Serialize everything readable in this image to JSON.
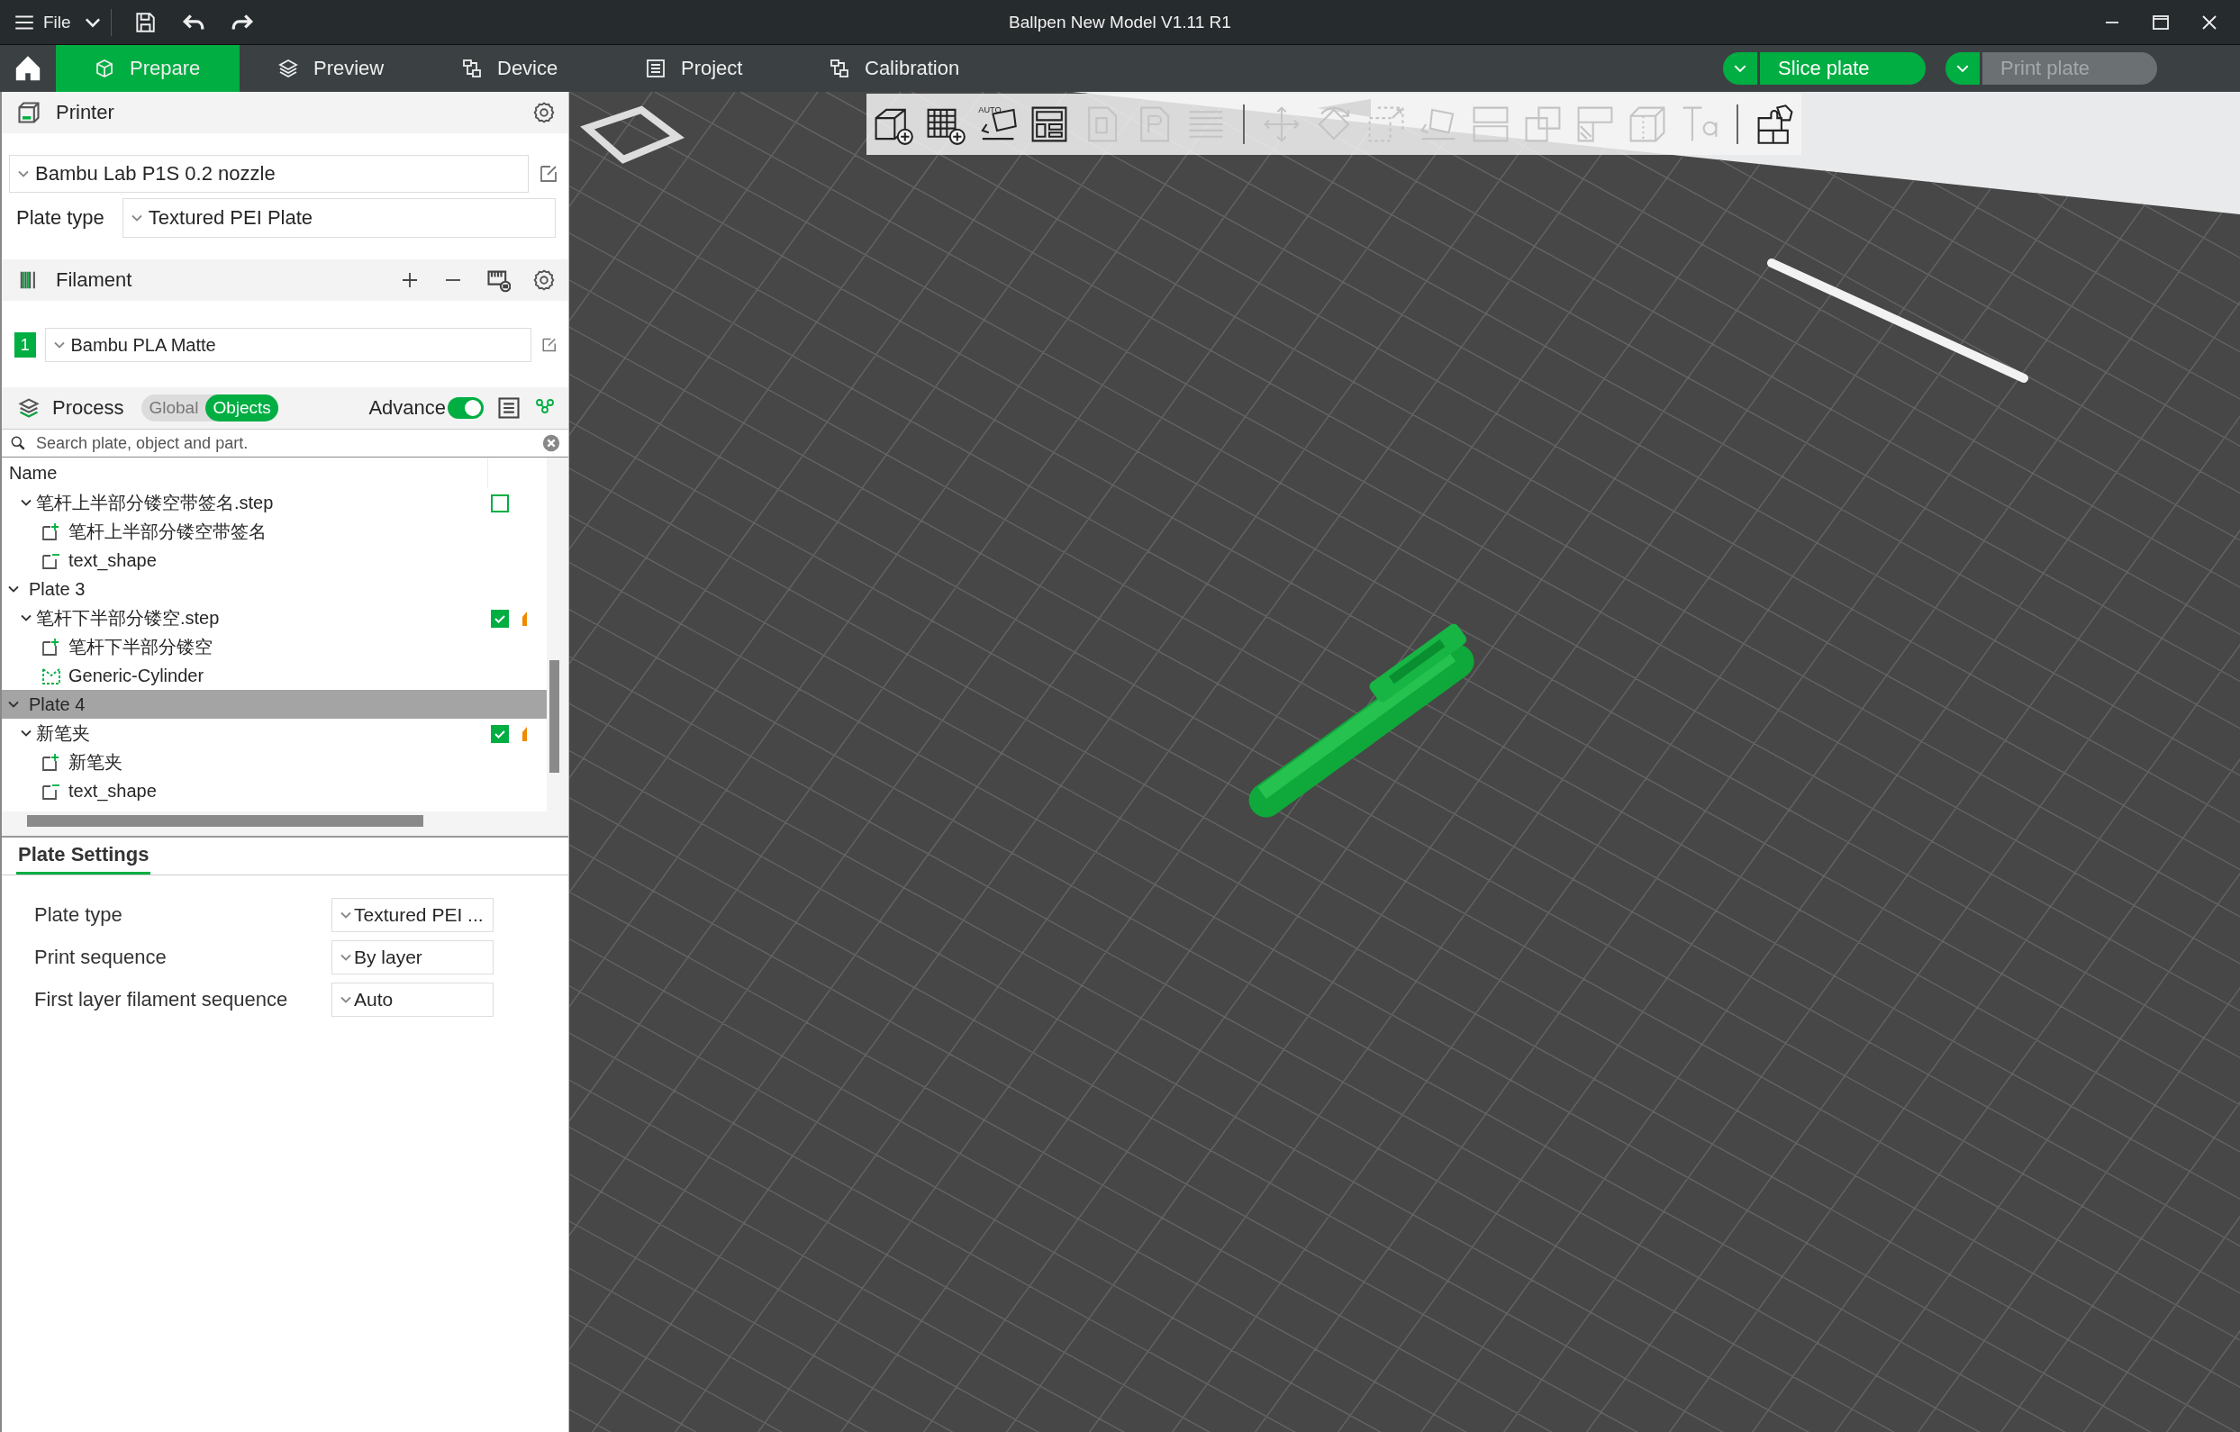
{
  "title_bar": {
    "menu": "File",
    "title": "Ballpen New Model V1.11 R1"
  },
  "tabs": [
    {
      "label": "Prepare",
      "selected": true
    },
    {
      "label": "Preview",
      "selected": false
    },
    {
      "label": "Device",
      "selected": false
    },
    {
      "label": "Project",
      "selected": false
    },
    {
      "label": "Calibration",
      "selected": false
    }
  ],
  "actions": [
    {
      "label": "Slice plate",
      "disabled": false
    },
    {
      "label": "Print plate",
      "disabled": true
    }
  ],
  "printer": {
    "heading": "Printer",
    "preset": "Bambu Lab P1S 0.2 nozzle",
    "plate_type_label": "Plate type",
    "plate_type": "Textured PEI Plate"
  },
  "filament": {
    "heading": "Filament",
    "items": [
      {
        "number": "1",
        "name": "Bambu PLA Matte",
        "color": "#00ae42"
      }
    ]
  },
  "process": {
    "heading": "Process",
    "scopes": [
      {
        "label": "Global",
        "selected": false
      },
      {
        "label": "Objects",
        "selected": true
      }
    ],
    "advance_label": "Advance",
    "advance_on": true,
    "search_placeholder": "Search plate, object and part."
  },
  "object_list": {
    "column": "Name",
    "items": [
      {
        "kind": "object",
        "name": "笔杆上半部分镂空带签名.step",
        "expanded": true,
        "checked": false,
        "badge": false,
        "selected": false,
        "children": [
          {
            "kind": "part",
            "name": "笔杆上半部分镂空带签名",
            "selected": false
          },
          {
            "kind": "text",
            "name": "text_shape",
            "selected": false
          }
        ]
      },
      {
        "kind": "plate",
        "name": "Plate 3",
        "expanded": true,
        "selected": false,
        "children": [
          {
            "kind": "object",
            "name": "笔杆下半部分镂空.step",
            "expanded": true,
            "checked": true,
            "badge": true,
            "selected": false,
            "children": [
              {
                "kind": "part",
                "name": "笔杆下半部分镂空",
                "selected": false
              },
              {
                "kind": "modifier",
                "name": "Generic-Cylinder",
                "selected": false
              }
            ]
          }
        ]
      },
      {
        "kind": "plate",
        "name": "Plate 4",
        "expanded": true,
        "selected": true,
        "children": [
          {
            "kind": "object",
            "name": "新笔夹",
            "expanded": true,
            "checked": true,
            "badge": true,
            "selected": false,
            "children": [
              {
                "kind": "part",
                "name": "新笔夹",
                "selected": false
              },
              {
                "kind": "text",
                "name": "text_shape",
                "selected": false
              }
            ]
          }
        ]
      }
    ]
  },
  "plate_settings": {
    "tab": "Plate Settings",
    "rows": [
      {
        "label": "Plate type",
        "value": "Textured PEI ..."
      },
      {
        "label": "Print sequence",
        "value": "By layer"
      },
      {
        "label": "First layer filament sequence",
        "value": "Auto"
      }
    ]
  },
  "toolbar": [
    [
      {
        "kind": "add",
        "disabled": false
      },
      {
        "kind": "plate",
        "disabled": false
      },
      {
        "kind": "orient",
        "label": "AUTO",
        "disabled": false
      },
      {
        "kind": "arrange",
        "disabled": false
      },
      {
        "kind": "slot",
        "disabled": true
      },
      {
        "kind": "page",
        "disabled": true
      },
      {
        "kind": "lines",
        "disabled": true
      }
    ],
    [
      {
        "kind": "move",
        "disabled": true
      },
      {
        "kind": "rotate",
        "disabled": true
      },
      {
        "kind": "scale",
        "disabled": true
      },
      {
        "kind": "face",
        "disabled": true
      },
      {
        "kind": "cut",
        "disabled": true
      },
      {
        "kind": "boolean",
        "disabled": true
      },
      {
        "kind": "support",
        "disabled": true
      },
      {
        "kind": "seam",
        "disabled": true
      },
      {
        "kind": "text",
        "disabled": true
      }
    ],
    [
      {
        "kind": "assembly",
        "disabled": false
      }
    ]
  ]
}
